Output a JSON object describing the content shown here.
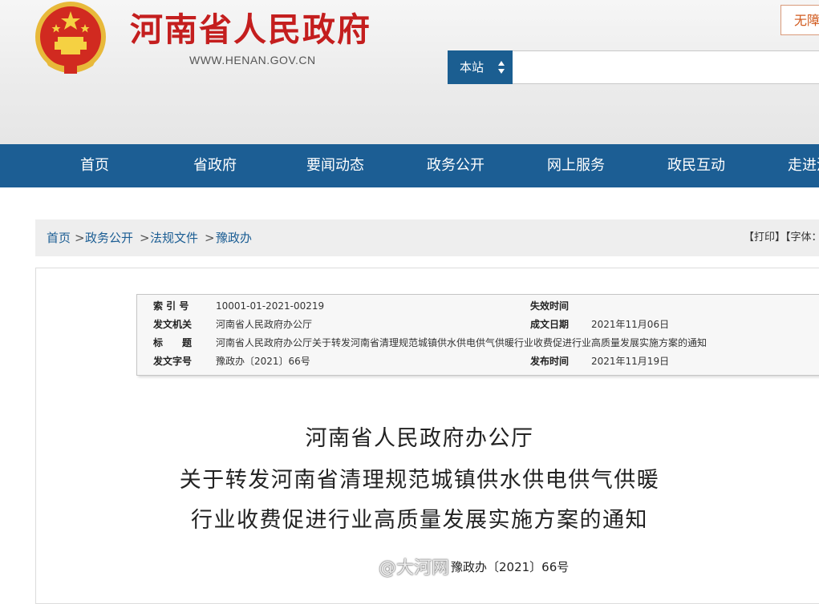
{
  "header": {
    "site_title": "河南省人民政府",
    "site_url": "WWW.HENAN.GOV.CN",
    "accessibility_label": "无障",
    "search_scope": "本站",
    "search_placeholder": ""
  },
  "nav": {
    "items": [
      "首页",
      "省政府",
      "要闻动态",
      "政务公开",
      "网上服务",
      "政民互动",
      "走进河"
    ]
  },
  "breadcrumb": {
    "items": [
      "首页",
      "政务公开",
      "法规文件",
      "豫政办"
    ],
    "separator": ">"
  },
  "tools": {
    "print": "【打印】",
    "font": "【字体：大"
  },
  "doc_info": {
    "index_label": "索 引 号",
    "index_value": "10001-01-2021-00219",
    "expiry_label": "失效时间",
    "expiry_value": "",
    "issuer_label": "发文机关",
    "issuer_value": "河南省人民政府办公厅",
    "date_label": "成文日期",
    "date_value": "2021年11月06日",
    "title_label": "标　　题",
    "title_value": "河南省人民政府办公厅关于转发河南省清理规范城镇供水供电供气供暖行业收费促进行业高质量发展实施方案的通知",
    "docno_label": "发文字号",
    "docno_value": "豫政办〔2021〕66号",
    "publish_label": "发布时间",
    "publish_value": "2021年11月19日"
  },
  "document": {
    "title_line1": "河南省人民政府办公厅",
    "title_line2": "关于转发河南省清理规范城镇供水供电供气供暖",
    "title_line3": "行业收费促进行业高质量发展实施方案的通知",
    "number": "豫政办〔2021〕66号"
  },
  "watermark": {
    "text": "@大河网"
  },
  "colors": {
    "brand_red": "#c41e1e",
    "nav_blue": "#1c5e94",
    "link_blue": "#1c5e94"
  }
}
